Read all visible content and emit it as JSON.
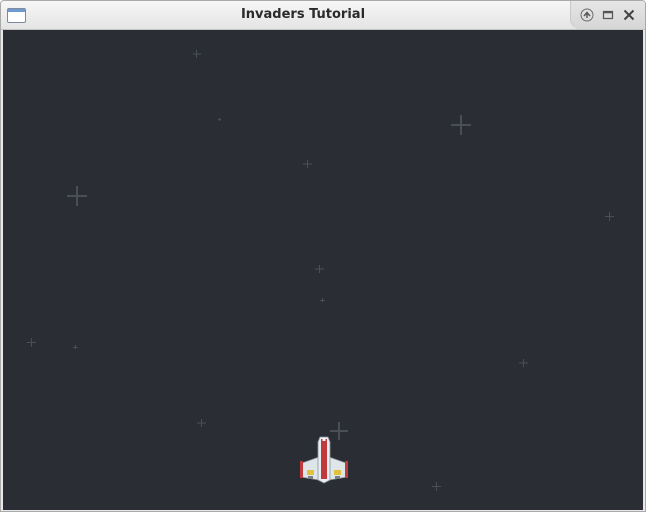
{
  "window": {
    "title": "Invaders Tutorial"
  },
  "controls": [
    {
      "name": "shade-button",
      "icon": "shade-up-icon"
    },
    {
      "name": "maximize-button",
      "icon": "maximize-icon"
    },
    {
      "name": "close-button",
      "icon": "close-icon"
    }
  ],
  "game": {
    "background_color": "#2b2d34",
    "star_color": "#4b4f5a",
    "player_ship": {
      "icon": "spaceship-icon",
      "colors": {
        "hull": "#e8eef2",
        "stripe": "#c0393b",
        "wing_accent": "#e0c33a"
      }
    }
  }
}
